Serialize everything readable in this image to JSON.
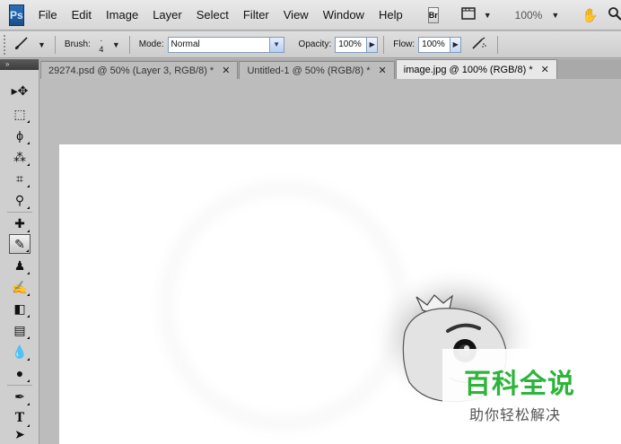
{
  "menubar": {
    "logo": "Ps",
    "items": [
      "File",
      "Edit",
      "Image",
      "Layer",
      "Select",
      "Filter",
      "View",
      "Window",
      "Help"
    ],
    "bridge_label": "Br",
    "zoom": "100%",
    "icons": [
      "film-strip-icon",
      "hand-icon",
      "zoom-icon",
      "rotate-icon"
    ]
  },
  "options": {
    "brush_label": "Brush:",
    "brush_size": "4",
    "mode_label": "Mode:",
    "mode_value": "Normal",
    "opacity_label": "Opacity:",
    "opacity_value": "100%",
    "flow_label": "Flow:",
    "flow_value": "100%"
  },
  "tabs": [
    {
      "label": "29274.psd @ 50% (Layer 3, RGB/8) *",
      "active": false
    },
    {
      "label": "Untitled-1 @ 50% (RGB/8) *",
      "active": false
    },
    {
      "label": "image.jpg @ 100% (RGB/8) *",
      "active": true
    }
  ],
  "toolbar": {
    "collapse_glyph": "»",
    "tools": [
      {
        "name": "move-tool",
        "glyph": "▸✥"
      },
      {
        "name": "marquee-tool",
        "glyph": "⬚"
      },
      {
        "name": "lasso-tool",
        "glyph": "ϕ"
      },
      {
        "name": "magic-wand-tool",
        "glyph": "⁂"
      },
      {
        "name": "crop-tool",
        "glyph": "⌗"
      },
      {
        "name": "eyedropper-tool",
        "glyph": "⚲"
      },
      {
        "name": "healing-brush-tool",
        "glyph": "✚"
      },
      {
        "name": "brush-tool",
        "glyph": "✎"
      },
      {
        "name": "clone-stamp-tool",
        "glyph": "♟"
      },
      {
        "name": "history-brush-tool",
        "glyph": "✍"
      },
      {
        "name": "eraser-tool",
        "glyph": "◧"
      },
      {
        "name": "gradient-tool",
        "glyph": "▤"
      },
      {
        "name": "blur-tool",
        "glyph": "💧"
      },
      {
        "name": "dodge-tool",
        "glyph": "●"
      },
      {
        "name": "pen-tool",
        "glyph": "✒"
      },
      {
        "name": "type-tool",
        "glyph": "T"
      },
      {
        "name": "path-selection-tool",
        "glyph": "➤"
      }
    ]
  },
  "watermark": {
    "title": "百科全说",
    "subtitle": "助你轻松解决",
    "color": "#2db53b"
  }
}
